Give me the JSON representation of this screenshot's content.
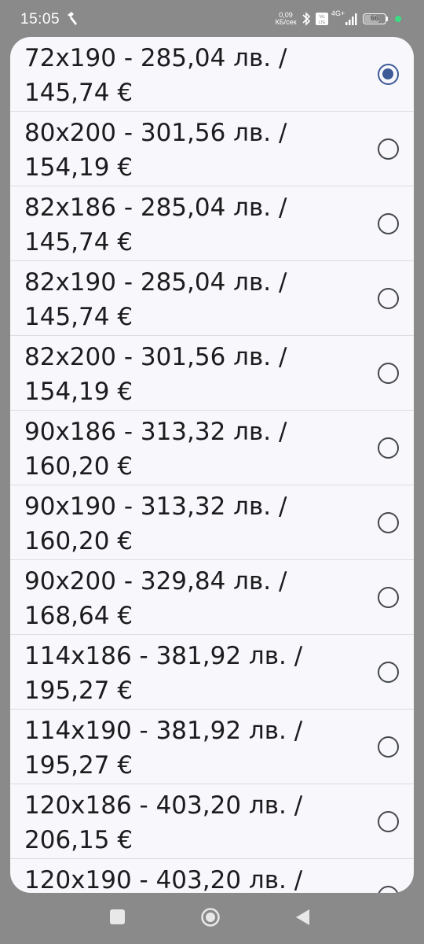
{
  "status_bar": {
    "time": "15:05",
    "net_speed_value": "0,09",
    "net_speed_unit": "КБ/сек",
    "volte": "Vo LTE",
    "network_type": "4G+",
    "battery_level": "66",
    "battery_fraction": 0.66
  },
  "size_options": {
    "selected_index": 0,
    "items": [
      {
        "label": "72x190 - 285,04 лв. / 145,74 €"
      },
      {
        "label": "80x200 - 301,56 лв. / 154,19 €"
      },
      {
        "label": "82x186 - 285,04 лв. / 145,74 €"
      },
      {
        "label": "82x190 - 285,04 лв. / 145,74 €"
      },
      {
        "label": "82x200 - 301,56 лв. / 154,19 €"
      },
      {
        "label": "90x186 - 313,32 лв. / 160,20 €"
      },
      {
        "label": "90x190 - 313,32 лв. / 160,20 €"
      },
      {
        "label": "90x200 - 329,84 лв. / 168,64 €"
      },
      {
        "label": "114x186 - 381,92 лв. / 195,27 €"
      },
      {
        "label": "114x190 - 381,92 лв. / 195,27 €"
      },
      {
        "label": "120x186 - 403,20 лв. / 206,15 €"
      },
      {
        "label": "120x190 - 403,20 лв. /"
      }
    ]
  },
  "colors": {
    "accent": "#3e5a96",
    "dialog_background": "#f8f8fc",
    "scrim": "#8a8a8a"
  }
}
